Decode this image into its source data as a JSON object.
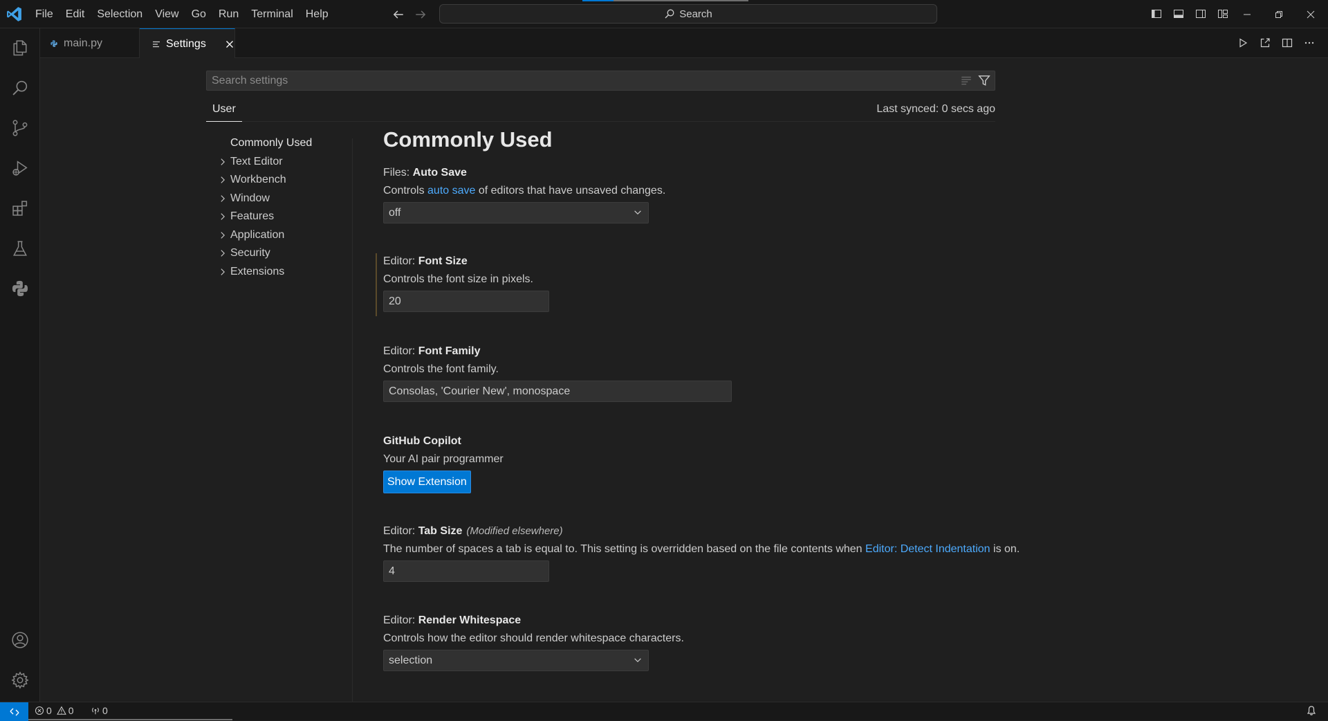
{
  "colors": {
    "accent": "#0078d4",
    "link": "#4daafc",
    "background": "#1f1f1f",
    "chrome": "#181818"
  },
  "menu": [
    "File",
    "Edit",
    "Selection",
    "View",
    "Go",
    "Run",
    "Terminal",
    "Help"
  ],
  "command_center": {
    "label": "Search",
    "icon": "search-icon"
  },
  "activity_bar": [
    {
      "name": "explorer",
      "icon": "files-icon"
    },
    {
      "name": "search",
      "icon": "search-icon"
    },
    {
      "name": "source-control",
      "icon": "source-control-icon"
    },
    {
      "name": "run-and-debug",
      "icon": "debug-icon"
    },
    {
      "name": "extensions",
      "icon": "extensions-icon"
    },
    {
      "name": "testing",
      "icon": "beaker-icon"
    },
    {
      "name": "python",
      "icon": "python-icon"
    }
  ],
  "activity_bottom": [
    {
      "name": "accounts",
      "icon": "account-icon"
    },
    {
      "name": "manage",
      "icon": "gear-icon"
    }
  ],
  "tabs": [
    {
      "label": "main.py",
      "icon": "python-file-icon",
      "active": false
    },
    {
      "label": "Settings",
      "icon": "settings-editor-icon",
      "active": true
    }
  ],
  "settings": {
    "search_placeholder": "Search settings",
    "scope_tab": "User",
    "sync_status": "Last synced: 0 secs ago",
    "toc": [
      {
        "label": "Commonly Used",
        "expandable": false
      },
      {
        "label": "Text Editor",
        "expandable": true
      },
      {
        "label": "Workbench",
        "expandable": true
      },
      {
        "label": "Window",
        "expandable": true
      },
      {
        "label": "Features",
        "expandable": true
      },
      {
        "label": "Application",
        "expandable": true
      },
      {
        "label": "Security",
        "expandable": true
      },
      {
        "label": "Extensions",
        "expandable": true
      }
    ],
    "section_title": "Commonly Used",
    "auto_save": {
      "category": "Files: ",
      "name": "Auto Save",
      "desc_prefix": "Controls ",
      "desc_link": "auto save",
      "desc_suffix": " of editors that have unsaved changes.",
      "value": "off"
    },
    "font_size": {
      "category": "Editor: ",
      "name": "Font Size",
      "description": "Controls the font size in pixels.",
      "value": "20"
    },
    "font_family": {
      "category": "Editor: ",
      "name": "Font Family",
      "description": "Controls the font family.",
      "value": "Consolas, 'Courier New', monospace"
    },
    "copilot": {
      "name": "GitHub Copilot",
      "description": "Your AI pair programmer",
      "button": "Show Extension"
    },
    "tab_size": {
      "category": "Editor: ",
      "name": "Tab Size",
      "note": "(Modified elsewhere)",
      "desc_prefix": "The number of spaces a tab is equal to. This setting is overridden based on the file contents when ",
      "desc_link": "Editor: Detect Indentation",
      "desc_suffix": " is on.",
      "value": "4"
    },
    "render_whitespace": {
      "category": "Editor: ",
      "name": "Render Whitespace",
      "description": "Controls how the editor should render whitespace characters.",
      "value": "selection"
    }
  },
  "status_bar": {
    "errors": "0",
    "warnings": "0",
    "ports": "0"
  }
}
